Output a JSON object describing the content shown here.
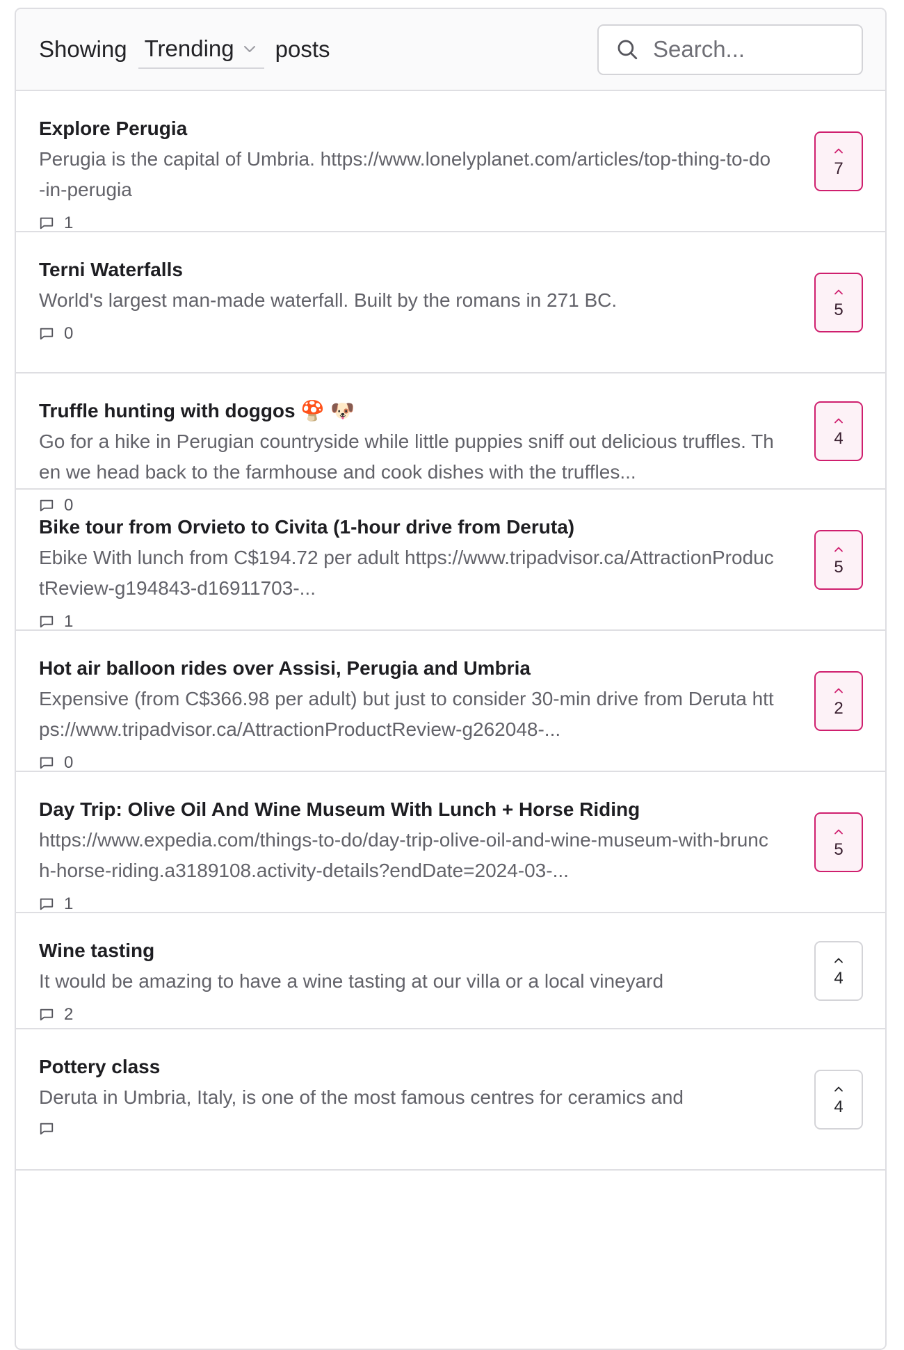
{
  "colors": {
    "upvoted_accent": "#cf1f6e",
    "upvoted_background": "#fdf2f7",
    "border": "#dedee2"
  },
  "toolbar": {
    "showing_label": "Showing",
    "sort_value": "Trending",
    "posts_label": "posts",
    "search_placeholder": "Search..."
  },
  "posts": [
    {
      "title": "Explore Perugia",
      "body": "Perugia is the capital of Umbria. https://www.lonelyplanet.com/articles/top-thing-to-do-in-perugia",
      "comments": "1",
      "votes": "7",
      "upvoted": true
    },
    {
      "title": "Terni Waterfalls",
      "body": "World's largest man-made waterfall. Built by the romans in 271 BC.",
      "comments": "0",
      "votes": "5",
      "upvoted": true
    },
    {
      "title": "Truffle hunting with doggos 🍄 🐶",
      "body": "Go for a hike in Perugian countryside while little puppies sniff out delicious truffles. Then we head back to the farmhouse and cook dishes with the truffles...",
      "comments": "0",
      "votes": "4",
      "upvoted": true
    },
    {
      "title": "Bike tour from Orvieto to Civita (1-hour drive from Deruta)",
      "body": "Ebike With lunch from C$194.72 per adult https://www.tripadvisor.ca/AttractionProductReview-g194843-d16911703-...",
      "comments": "1",
      "votes": "5",
      "upvoted": true
    },
    {
      "title": "Hot air balloon rides over Assisi, Perugia and Umbria",
      "body": "Expensive (from C$366.98 per adult) but just to consider 30-min drive from Deruta https://www.tripadvisor.ca/AttractionProductReview-g262048-...",
      "comments": "0",
      "votes": "2",
      "upvoted": true
    },
    {
      "title": "Day Trip: Olive Oil And Wine Museum With Lunch + Horse Riding",
      "body": "https://www.expedia.com/things-to-do/day-trip-olive-oil-and-wine-museum-with-brunch-horse-riding.a3189108.activity-details?endDate=2024-03-...",
      "comments": "1",
      "votes": "5",
      "upvoted": true
    },
    {
      "title": "Wine tasting",
      "body": "It would be amazing to have a wine tasting at our villa or a local vineyard",
      "comments": "2",
      "votes": "4",
      "upvoted": false
    },
    {
      "title": "Pottery class",
      "body": "Deruta in Umbria, Italy, is one of the most famous centres for ceramics and",
      "comments": "",
      "votes": "4",
      "upvoted": false
    }
  ]
}
